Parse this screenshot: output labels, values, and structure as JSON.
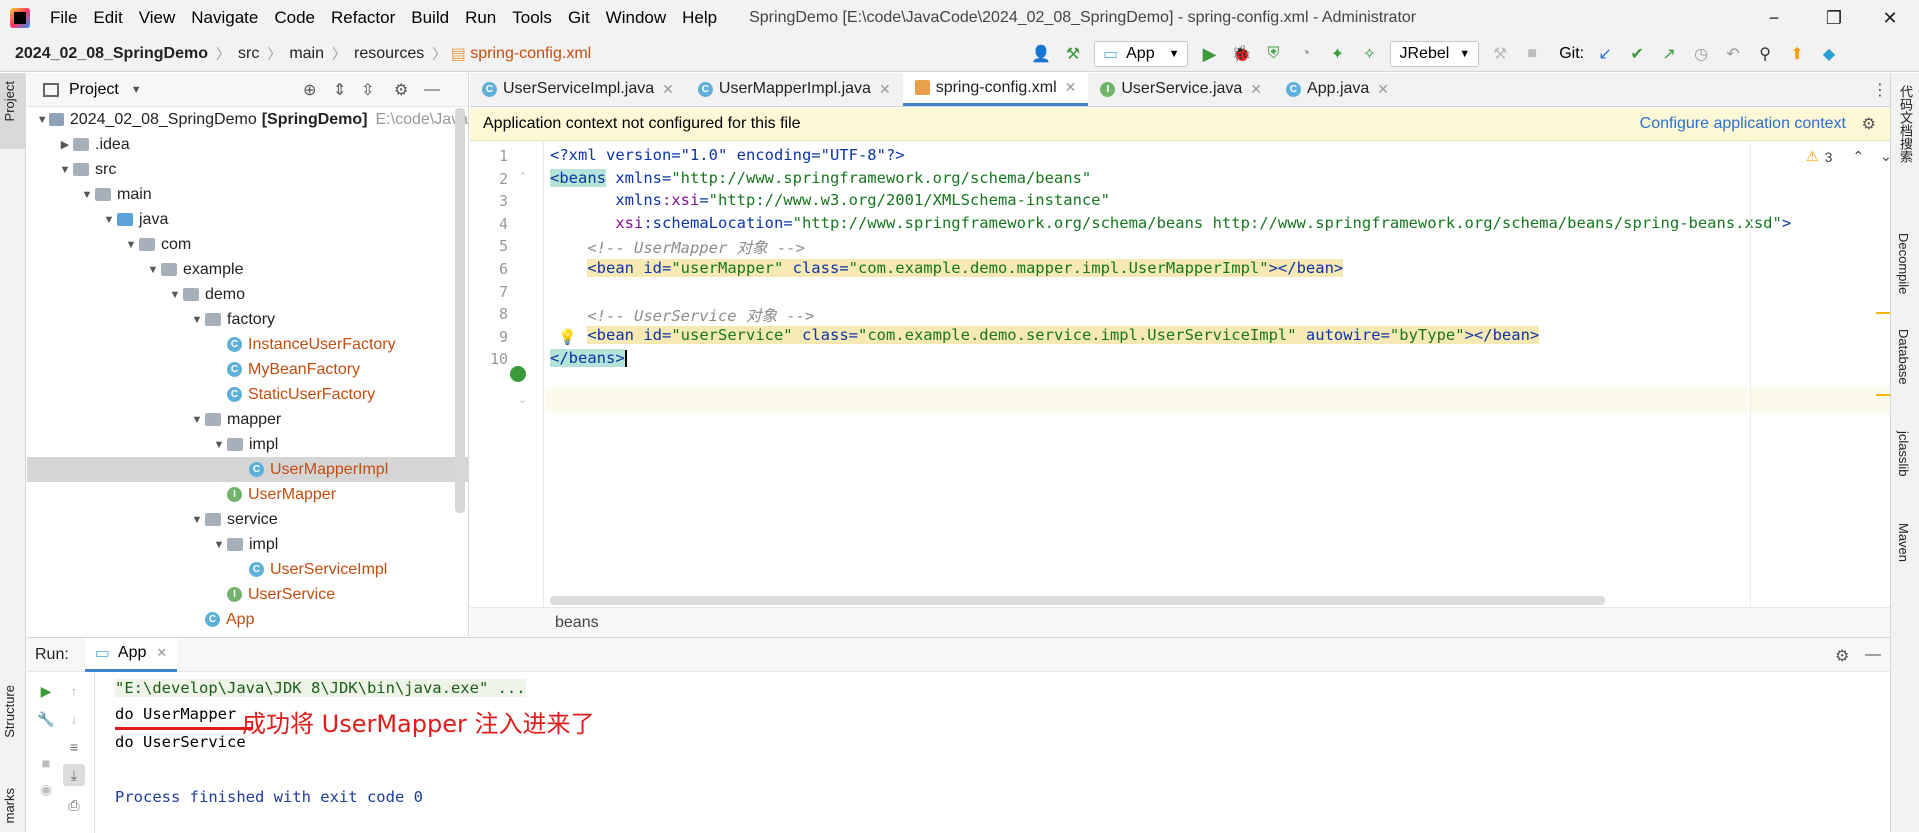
{
  "app": {
    "title": "SpringDemo [E:\\code\\JavaCode\\2024_02_08_SpringDemo] - spring-config.xml - Administrator"
  },
  "menu": [
    "File",
    "Edit",
    "View",
    "Navigate",
    "Code",
    "Refactor",
    "Build",
    "Run",
    "Tools",
    "Git",
    "Window",
    "Help"
  ],
  "window_buttons": {
    "minimize": "−",
    "restore": "❐",
    "close": "✕"
  },
  "breadcrumb": {
    "project": "2024_02_08_SpringDemo",
    "items": [
      "src",
      "main",
      "resources"
    ],
    "file": "spring-config.xml"
  },
  "toolbar": {
    "run_config": "App",
    "jrebel": "JRebel",
    "git_label": "Git:"
  },
  "project_panel": {
    "title": "Project",
    "tree": [
      {
        "level": 0,
        "arrow": "▼",
        "icon": "module",
        "label": "2024_02_08_SpringDemo",
        "bold": "[SpringDemo]",
        "extra": "E:\\code\\Java"
      },
      {
        "level": 1,
        "arrow": "▶",
        "icon": "folder",
        "label": ".idea"
      },
      {
        "level": 1,
        "arrow": "▼",
        "icon": "folder",
        "label": "src"
      },
      {
        "level": 2,
        "arrow": "▼",
        "icon": "folder",
        "label": "main"
      },
      {
        "level": 3,
        "arrow": "▼",
        "icon": "folder-blue",
        "label": "java"
      },
      {
        "level": 4,
        "arrow": "▼",
        "icon": "package",
        "label": "com"
      },
      {
        "level": 5,
        "arrow": "▼",
        "icon": "package",
        "label": "example"
      },
      {
        "level": 6,
        "arrow": "▼",
        "icon": "package",
        "label": "demo"
      },
      {
        "level": 7,
        "arrow": "▼",
        "icon": "package",
        "label": "factory"
      },
      {
        "level": 8,
        "arrow": "",
        "icon": "class",
        "label": "InstanceUserFactory",
        "java": true
      },
      {
        "level": 8,
        "arrow": "",
        "icon": "class",
        "label": "MyBeanFactory",
        "java": true
      },
      {
        "level": 8,
        "arrow": "",
        "icon": "class",
        "label": "StaticUserFactory",
        "java": true
      },
      {
        "level": 7,
        "arrow": "▼",
        "icon": "package",
        "label": "mapper"
      },
      {
        "level": 8,
        "arrow": "▼",
        "icon": "package",
        "label": "impl"
      },
      {
        "level": 9,
        "arrow": "",
        "icon": "class",
        "label": "UserMapperImpl",
        "java": true,
        "selected": true
      },
      {
        "level": 8,
        "arrow": "",
        "icon": "interface",
        "label": "UserMapper",
        "java": true
      },
      {
        "level": 7,
        "arrow": "▼",
        "icon": "package",
        "label": "service"
      },
      {
        "level": 8,
        "arrow": "▼",
        "icon": "package",
        "label": "impl"
      },
      {
        "level": 9,
        "arrow": "",
        "icon": "class",
        "label": "UserServiceImpl",
        "java": true
      },
      {
        "level": 8,
        "arrow": "",
        "icon": "interface",
        "label": "UserService",
        "java": true
      },
      {
        "level": 7,
        "arrow": "",
        "icon": "main",
        "label": "App",
        "java": true
      }
    ]
  },
  "editor_tabs": [
    {
      "label": "UserServiceImpl.java",
      "icon": "class",
      "active": false
    },
    {
      "label": "UserMapperImpl.java",
      "icon": "class",
      "active": false
    },
    {
      "label": "spring-config.xml",
      "icon": "xml",
      "active": true
    },
    {
      "label": "UserService.java",
      "icon": "interface",
      "active": false
    },
    {
      "label": "App.java",
      "icon": "class",
      "active": false
    }
  ],
  "banner": {
    "message": "Application context not configured for this file",
    "link": "Configure application context"
  },
  "editor": {
    "warnings": "3",
    "lines": [
      "1",
      "2",
      "3",
      "4",
      "5",
      "6",
      "7",
      "8",
      "9",
      "10"
    ],
    "code": {
      "l1_pi": "<?xml version=\"1.0\" encoding=\"UTF-8\"?>",
      "l2_tag": "<beans",
      "l2_attr": " xmlns=",
      "l2_val": "\"http://www.springframework.org/schema/beans\"",
      "l3_pre": "       xmlns",
      "l3_ns": ":xsi",
      "l3_eq": "=",
      "l3_val": "\"http://www.w3.org/2001/XMLSchema-instance\"",
      "l4_ns": "       xsi",
      "l4_attr": ":schemaLocation=",
      "l4_val": "\"http://www.springframework.org/schema/beans http://www.springframework.org/schema/beans/spring-beans.xsd\"",
      "l4_end": ">",
      "l5": "    <!-- UserMapper 对象 -->",
      "l6_tag": "<bean",
      "l6_a1": " id=",
      "l6_v1": "\"userMapper\"",
      "l6_a2": " class=",
      "l6_v2": "\"com.example.demo.mapper.impl.UserMapperImpl\"",
      "l6_end": "></bean>",
      "l8": "    <!-- UserService 对象 -->",
      "l9_tag": "<bean",
      "l9_a1": " id=",
      "l9_v1": "\"userService\"",
      "l9_a2": " class=",
      "l9_v2": "\"com.example.demo.service.impl.UserServiceImpl\"",
      "l9_a3": " autowire=",
      "l9_v3": "\"byType\"",
      "l9_end": "></bean>",
      "l10": "</beans>"
    },
    "footer_crumb": "beans"
  },
  "right_tabs": [
    "代码文档搜索",
    "Decompile",
    "Database",
    "jclasslib",
    "Maven"
  ],
  "left_tabs": [
    "Project",
    "Structure",
    "marks"
  ],
  "run": {
    "label": "Run:",
    "tab": "App",
    "console": [
      "\"E:\\develop\\Java\\JDK 8\\JDK\\bin\\java.exe\" ...",
      "do UserMapper",
      "do UserService",
      "",
      "Process finished with exit code 0"
    ],
    "annotation": "成功将 UserMapper 注入进来了"
  },
  "colors": {
    "accent": "#4083c9",
    "annotation": "#e21b1b",
    "java_file": "#c44d0f"
  }
}
